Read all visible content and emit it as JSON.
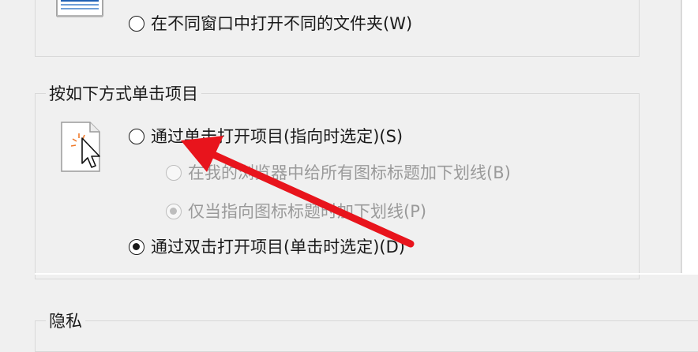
{
  "group_window": {
    "option_new_window": {
      "label": "在不同窗口中打开不同的文件夹(W)",
      "checked": false
    }
  },
  "group_click": {
    "legend": "按如下方式单击项目",
    "option_single_click": {
      "label": "通过单击打开项目(指向时选定)(S)",
      "checked": false
    },
    "option_underline_always": {
      "label": "在我的浏览器中给所有图标标题加下划线(B)",
      "checked": false,
      "enabled": false
    },
    "option_underline_hover": {
      "label": "仅当指向图标标题时加下划线(P)",
      "checked": true,
      "enabled": false
    },
    "option_double_click": {
      "label": "通过双击打开项目(单击时选定)(D)",
      "checked": true
    }
  },
  "group_privacy": {
    "legend": "隐私"
  },
  "annotation": {
    "arrow_color": "#e8141c"
  }
}
